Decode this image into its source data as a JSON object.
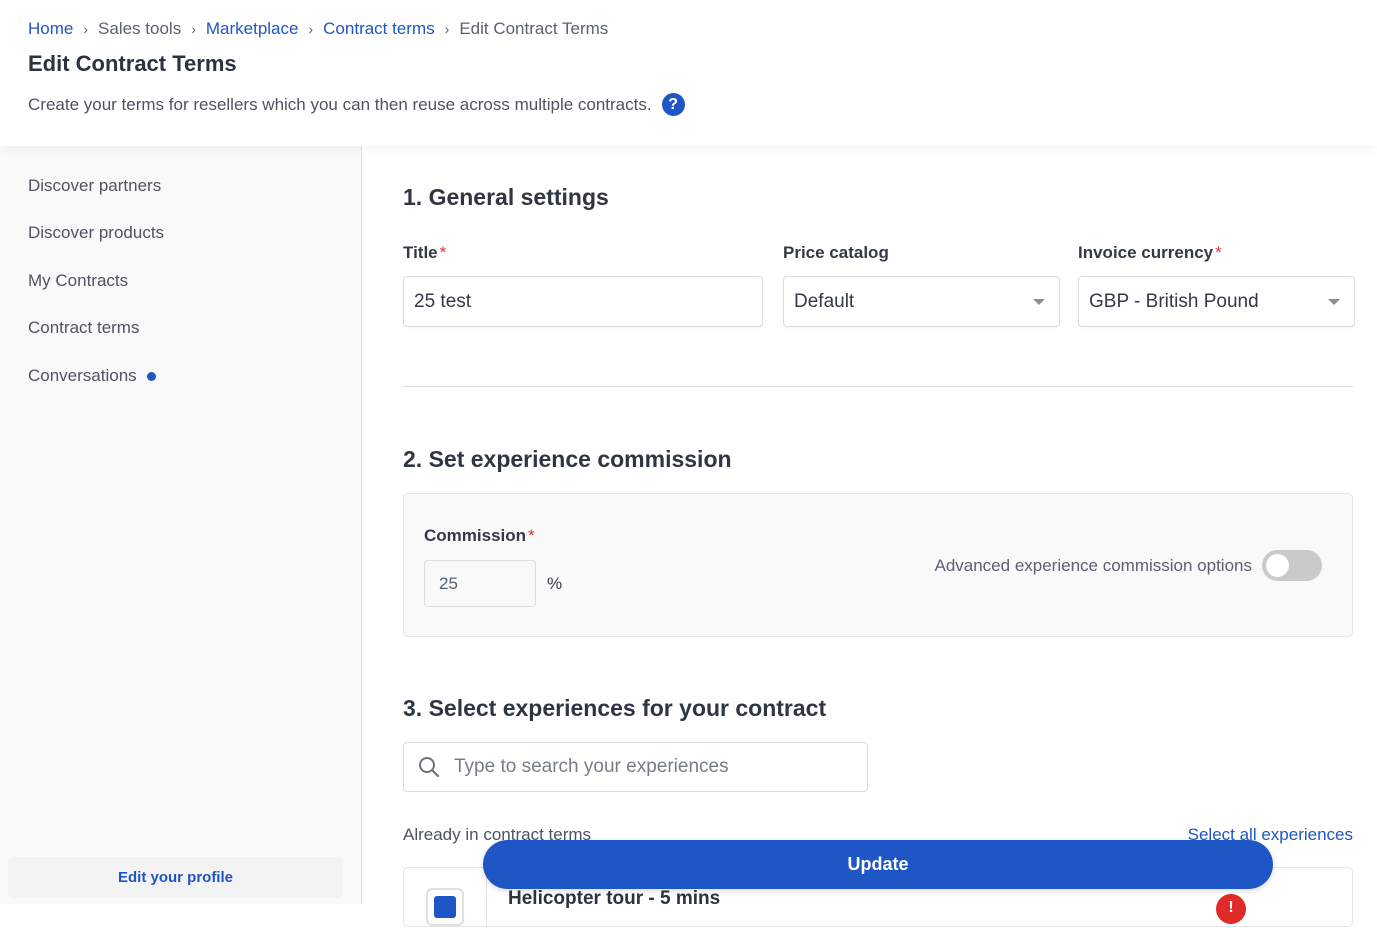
{
  "breadcrumb": [
    {
      "label": "Home",
      "link": true
    },
    {
      "label": "Sales tools",
      "link": false
    },
    {
      "label": "Marketplace",
      "link": true
    },
    {
      "label": "Contract terms",
      "link": true
    },
    {
      "label": "Edit Contract Terms",
      "link": false
    }
  ],
  "header": {
    "title": "Edit Contract Terms",
    "subtitle": "Create your terms for resellers which you can then reuse across multiple contracts.",
    "help_icon": "?"
  },
  "sidebar": {
    "items": [
      {
        "label": "Discover partners"
      },
      {
        "label": "Discover products"
      },
      {
        "label": "My Contracts"
      },
      {
        "label": "Contract terms"
      },
      {
        "label": "Conversations",
        "has_notification": true
      }
    ],
    "profile_button": "Edit your profile"
  },
  "general_settings": {
    "title": "1. General settings",
    "title_field": {
      "label": "Title",
      "required_mark": "*",
      "value": "25 test"
    },
    "price_catalog": {
      "label": "Price catalog",
      "value": "Default"
    },
    "invoice_currency": {
      "label": "Invoice currency",
      "required_mark": "*",
      "value": "GBP - British Pound"
    }
  },
  "commission": {
    "title": "2. Set experience commission",
    "label": "Commission",
    "required_mark": "*",
    "value": "25",
    "unit": "%",
    "advanced_label": "Advanced experience commission options",
    "advanced_enabled": false
  },
  "experiences": {
    "title": "3. Select experiences for your contract",
    "search_placeholder": "Type to search your experiences",
    "already_label": "Already in contract terms",
    "select_all": "Select all experiences",
    "items": [
      {
        "title": "Helicopter tour - 5 mins",
        "checked": true
      }
    ]
  },
  "actions": {
    "update": "Update"
  },
  "colors": {
    "accent": "#1f56c5",
    "required": "#e03030",
    "remove": "#e02a2a"
  }
}
